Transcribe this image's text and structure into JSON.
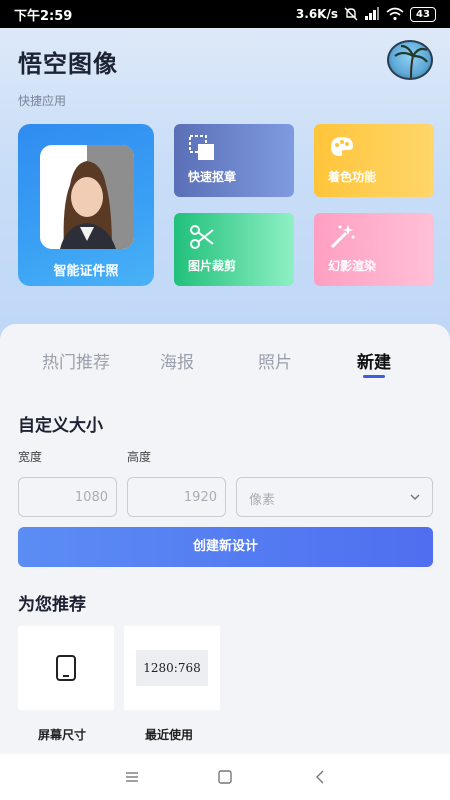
{
  "status_bar": {
    "time": "下午2:59",
    "speed": "3.6K/s",
    "battery": "43"
  },
  "app": {
    "title": "悟空图像"
  },
  "quick_apps": {
    "caption": "快捷应用",
    "featured": {
      "label": "智能证件照",
      "icon": "id-photo-portrait"
    },
    "tiles": [
      {
        "label": "快速抠章",
        "icon": "cutout-icon",
        "color": "#6b84cc"
      },
      {
        "label": "着色功能",
        "icon": "palette-icon",
        "color": "#ffc94a"
      },
      {
        "label": "图片裁剪",
        "icon": "scissors-icon",
        "color": "#3fd08f"
      },
      {
        "label": "幻影渲染",
        "icon": "magic-wand-icon",
        "color": "#ffadc9"
      }
    ]
  },
  "tabs": [
    {
      "label": "热门推荐",
      "active": false
    },
    {
      "label": "海报",
      "active": false
    },
    {
      "label": "照片",
      "active": false
    },
    {
      "label": "新建",
      "active": true
    }
  ],
  "custom_size": {
    "heading": "自定义大小",
    "width_label": "宽度",
    "height_label": "高度",
    "width_placeholder": "1080",
    "height_placeholder": "1920",
    "unit_selected": "像素",
    "create_button": "创建新设计"
  },
  "recommend": {
    "heading": "为您推荐",
    "items": [
      {
        "label": "屏幕尺寸",
        "icon": "tablet-icon"
      },
      {
        "label": "最近使用",
        "ratio_text": "1280:768"
      }
    ]
  },
  "colors": {
    "accent": "#3c5fe0",
    "button_gradient_start": "#5b8df4",
    "button_gradient_end": "#4f6ef0"
  }
}
